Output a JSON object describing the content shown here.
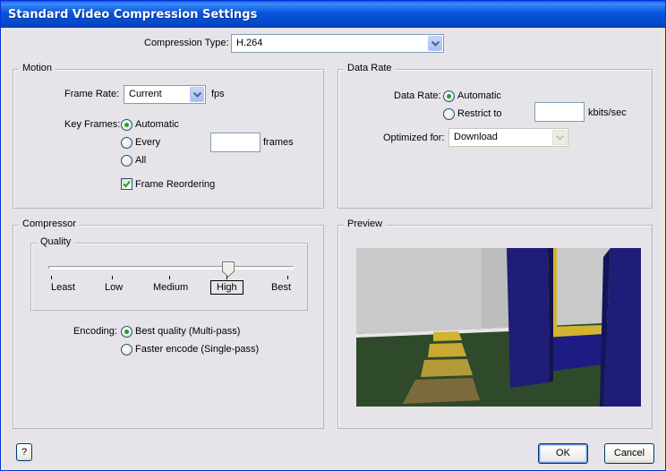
{
  "window": {
    "title": "Standard Video Compression Settings"
  },
  "compression": {
    "label": "Compression Type:",
    "value": "H.264"
  },
  "motion": {
    "title": "Motion",
    "frame_rate_label": "Frame Rate:",
    "frame_rate_value": "Current",
    "fps_unit": "fps",
    "key_frames_label": "Key Frames:",
    "key_frames_options": [
      "Automatic",
      "Every",
      "All"
    ],
    "key_frames_selected": "Automatic",
    "every_value": "",
    "frames_unit": "frames",
    "frame_reordering_label": "Frame Reordering",
    "frame_reordering_checked": true
  },
  "data_rate": {
    "title": "Data Rate",
    "label": "Data Rate:",
    "options": [
      "Automatic",
      "Restrict to"
    ],
    "selected": "Automatic",
    "restrict_value": "",
    "unit": "kbits/sec",
    "optimized_label": "Optimized for:",
    "optimized_value": "Download"
  },
  "compressor": {
    "title": "Compressor",
    "quality": {
      "title": "Quality",
      "levels": [
        "Least",
        "Low",
        "Medium",
        "High",
        "Best"
      ],
      "selected": "High",
      "value_fraction": 0.75
    },
    "encoding_label": "Encoding:",
    "encoding_options": [
      "Best quality (Multi-pass)",
      "Faster encode (Single-pass)"
    ],
    "encoding_selected": "Best quality (Multi-pass)"
  },
  "preview": {
    "title": "Preview"
  },
  "buttons": {
    "help": "?",
    "ok": "OK",
    "cancel": "Cancel"
  },
  "colors": {
    "title_bar": "#0855dd",
    "dialog_bg": "#e6e4e9",
    "preview_floor": "#2f4a2b",
    "preview_wall": "#c9c9c9",
    "preview_post": "#1e1e78",
    "preview_yellow": "#d2b431"
  }
}
